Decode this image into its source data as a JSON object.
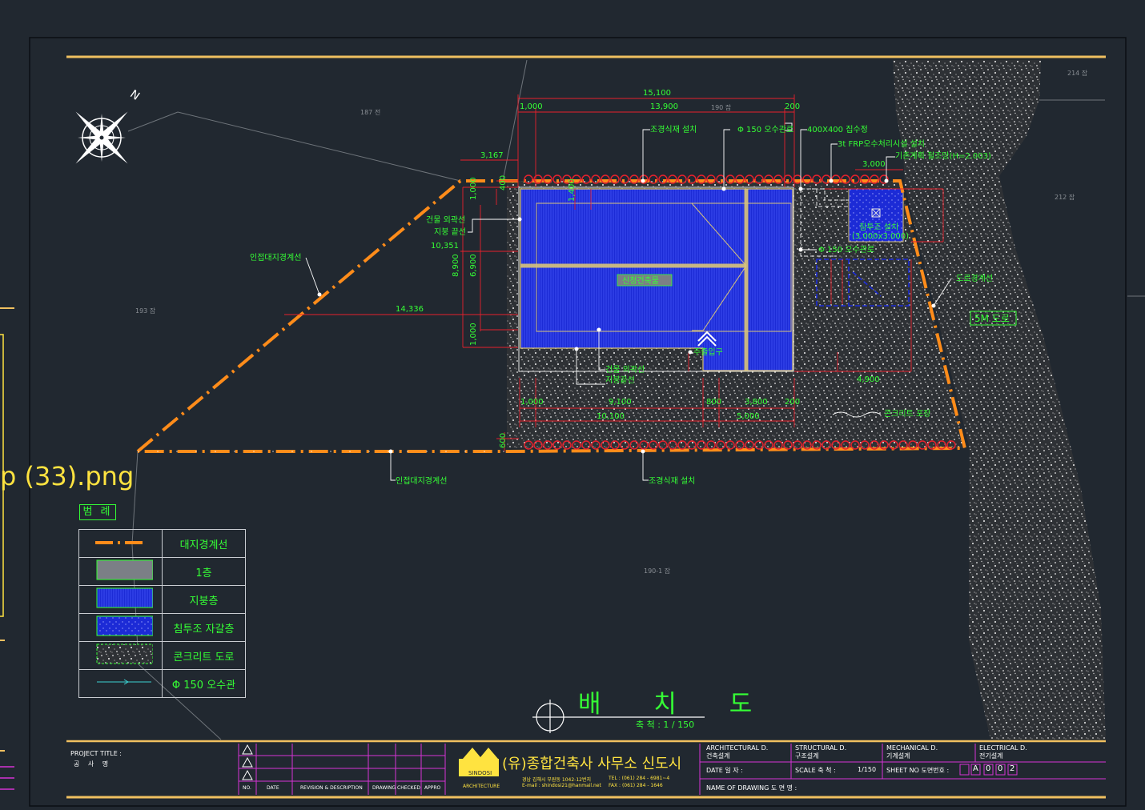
{
  "colors": {
    "background": "#212830",
    "boundary": "#ff8c1a",
    "dimension": "#e8212d",
    "annotation": "#35ff35",
    "roof": "#1c2bd6",
    "frame": "#f0c060",
    "title_block": "#d633d6"
  },
  "icons": {
    "north_arrow": "compass-rose-icon",
    "section_marker": "circle-crosshair-icon",
    "logo": "company-logo"
  },
  "file_label": "p (33).png",
  "north_label": "N",
  "lot_labels": {
    "lot_187": "187 전",
    "lot_190": "190 잡",
    "lot_214": "214 잡",
    "lot_212": "212 잡",
    "lot_193": "193 잡",
    "lot_190_1": "190-1 잡"
  },
  "dimensions": {
    "d_15100": "15,100",
    "d_1000_top": "1,000",
    "d_13900": "13,900",
    "d_200": "200",
    "d_3167": "3,167",
    "d_10351": "10,351",
    "d_14336": "14,336",
    "d_3000": "3,000",
    "d_8900": "8,900",
    "d_6900": "6,900",
    "d_1000_left": "1,000",
    "d_1000_b": "1,000",
    "d_1400": "1,400",
    "d_1000_bl": "1,000",
    "d_9100": "9,100",
    "d_10100": "10,100",
    "d_800": "800",
    "d_3800": "3,800",
    "d_5000": "5,000",
    "d_200_b": "200",
    "d_4900": "4,900",
    "d_400": "400",
    "d_600": "600"
  },
  "annotations": {
    "landscape_top": "조경식재 설치",
    "pipe_top": "Φ 150 오수관로",
    "catch_basin": "400X400 집수정",
    "frp_tank": "3t FRP오수처리시설 설치",
    "existing_fence": "기존계획 철조망(H=2.003)",
    "building_outline": "건물 외곽선",
    "roof_line": "지붕 끝선",
    "adjacent_boundary_left": "인접대지경계선",
    "infiltration": "침투조 설치",
    "infiltration_size": "(3.000x3.000)",
    "pipe_mid": "Φ 150 오수관로",
    "road_boundary": "도로경계선",
    "road_5m": "5M 도로",
    "new_building": "신청건축물",
    "entrance": "주출입구",
    "building_outline_b": "건물 외곽선",
    "roof_line_b": "지붕끝선",
    "concrete_road": "콘크리트 포장",
    "adjacent_boundary_bottom": "인접대지경계선",
    "landscape_bottom": "조경식재 설치"
  },
  "legend": {
    "title": "범 례",
    "rows": [
      {
        "label": "대지경계선",
        "swatch": "boundary-line"
      },
      {
        "label": "1층",
        "swatch": "grey-fill"
      },
      {
        "label": "지붕층",
        "swatch": "roof-hatch"
      },
      {
        "label": "침투조 자갈층",
        "swatch": "blue-gravel"
      },
      {
        "label": "콘크리트 도로",
        "swatch": "concrete"
      },
      {
        "label": "Φ 150 오수관",
        "swatch": "pipe-line"
      }
    ]
  },
  "drawing_title": "배 치 도",
  "drawing_scale": "축 척 : 1 / 150",
  "title_block": {
    "project_title_label": "PROJECT TITLE :",
    "project_title_kr": "공 사 명",
    "revision_headers": [
      "NO.",
      "DATE",
      "REVISION & DESCRIPTION",
      "DRAWING",
      "CHECKED",
      "APPRO"
    ],
    "company_name": "(유)종합건축사 사무소 신도시",
    "company_caption": "ARCHITECTURE",
    "logo_text": "SINDOSI",
    "address": "경남 김해시 부원동 1042-12번지",
    "email": "E-mail : shindosi21@hanmail.net",
    "tel": "TEL : (061) 284 - 6981~4",
    "fax": "FAX : (061) 284 - 1646",
    "arch_label": "ARCHITECTURAL D.",
    "arch_kr": "건축설계",
    "struct_label": "STRUCTURAL D.",
    "struct_kr": "구조설계",
    "mech_label": "MECHANICAL D.",
    "mech_kr": "기계설계",
    "elec_label": "ELECTRICAL D.",
    "elec_kr": "전기설계",
    "date_label": "DATE 일 자 :",
    "scale_label": "SCALE 축 척 :",
    "scale_value": "1/150",
    "sheet_label": "SHEET NO 도면번호 :",
    "sheet_chars": [
      "A",
      "0",
      "0",
      "2"
    ],
    "drawing_name_label": "NAME OF DRAWING 도 면 명 :"
  }
}
